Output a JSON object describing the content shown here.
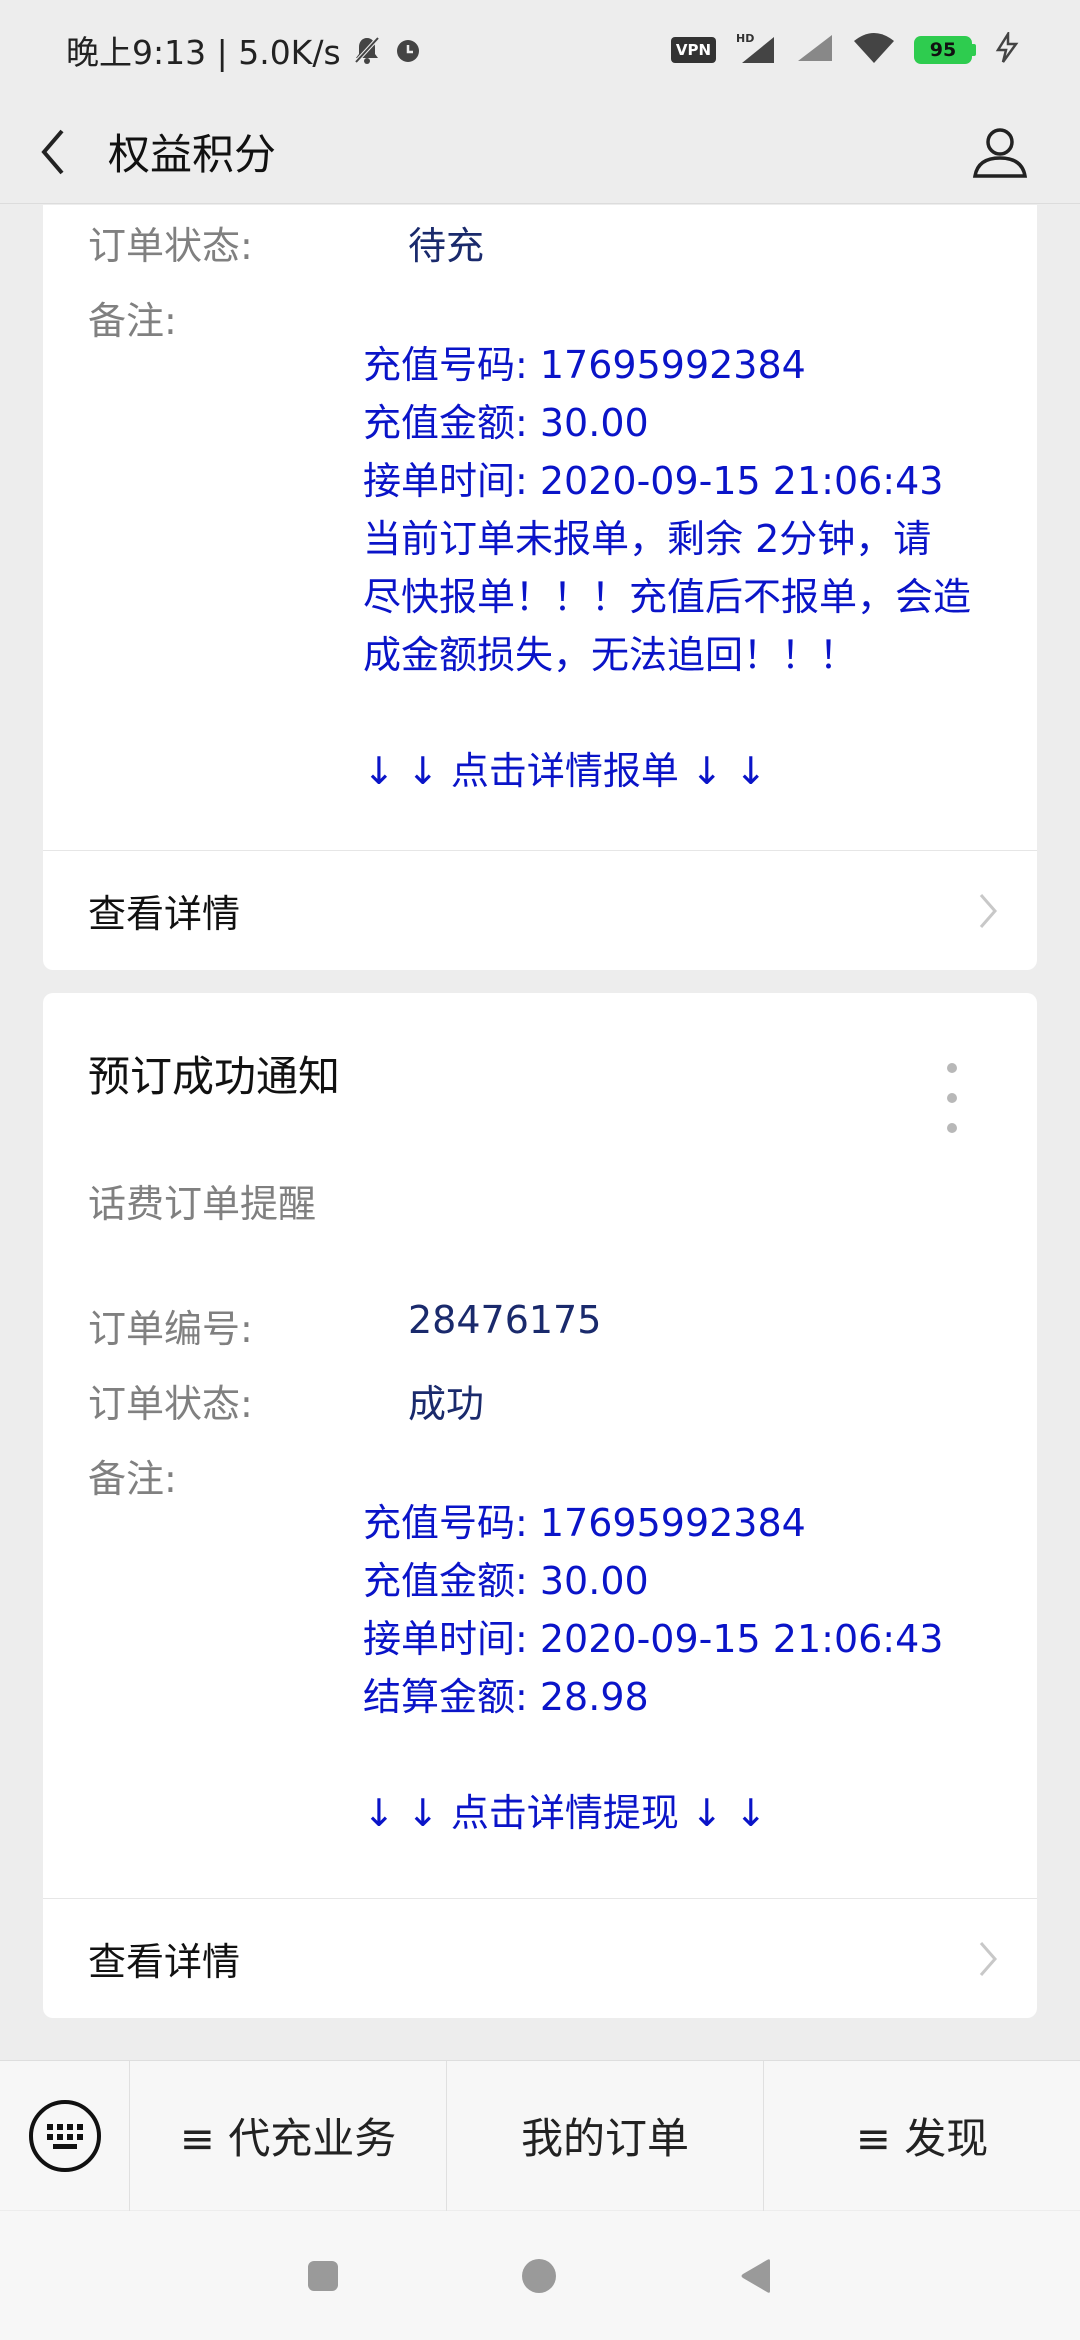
{
  "status_bar": {
    "time_speed": "晚上9:13 | 5.0K/s",
    "vpn": "VPN",
    "hd": "HD",
    "battery": "95"
  },
  "nav": {
    "title": "权益积分"
  },
  "card1": {
    "status_label": "订单状态:",
    "status_value": "待充",
    "remark_label": "备注:",
    "remark_lines": [
      "充值号码: 17695992384",
      "充值金额: 30.00",
      "接单时间: 2020-09-15 21:06:43",
      "当前订单未报单，剩余 2分钟，请",
      "尽快报单！！！充值后不报单，会造",
      "成金额损失，无法追回！！！"
    ],
    "cta": "↓ ↓ 点击详情报单 ↓ ↓",
    "detail_label": "查看详情"
  },
  "card2": {
    "title": "预订成功通知",
    "subtitle": "话费订单提醒",
    "order_no_label": "订单编号:",
    "order_no_value": "28476175",
    "status_label": "订单状态:",
    "status_value": "成功",
    "remark_label": "备注:",
    "remark_lines": [
      "充值号码: 17695992384",
      "充值金额: 30.00",
      "接单时间: 2020-09-15 21:06:43",
      "结算金额: 28.98"
    ],
    "cta": "↓ ↓ 点击详情提现 ↓ ↓",
    "detail_label": "查看详情"
  },
  "bottom_menu": {
    "items": [
      "≡ 代充业务",
      "我的订单",
      "≡ 发现"
    ]
  },
  "colors": {
    "accent_blue": "#0a14c8",
    "value_navy": "#1a2a6c",
    "battery_green": "#2ecc4f"
  }
}
